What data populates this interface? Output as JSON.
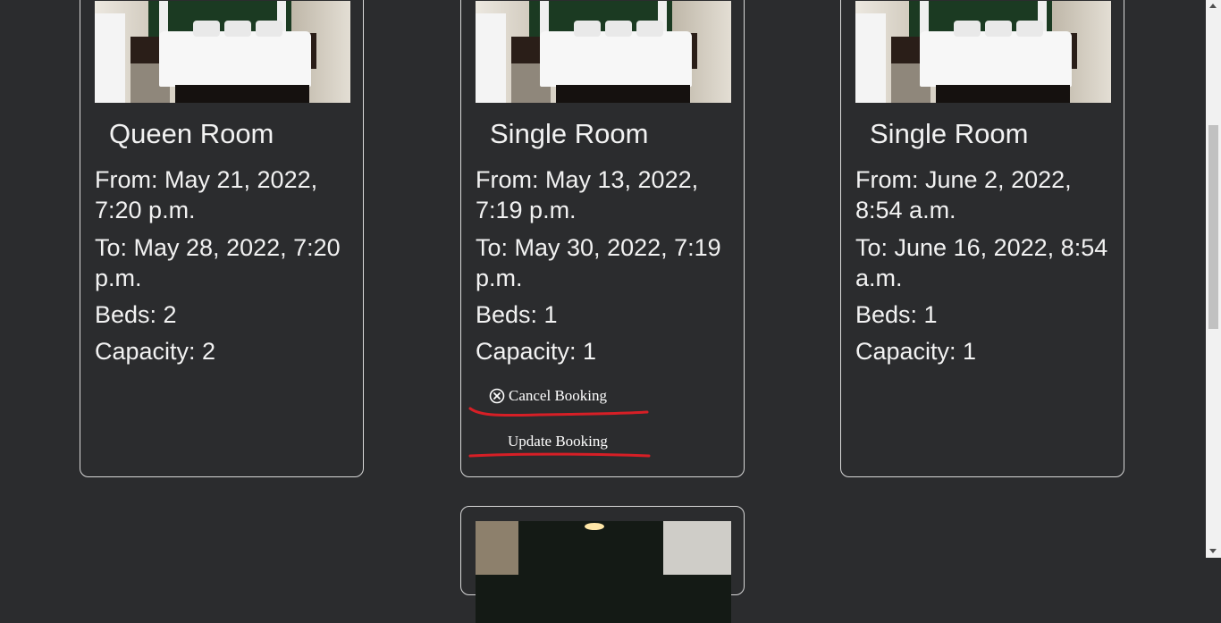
{
  "bookings": [
    {
      "title": "Queen Room",
      "from": "From: May 21, 2022, 7:20 p.m.",
      "to": "To: May 28, 2022, 7:20 p.m.",
      "beds": "Beds: 2",
      "capacity": "Capacity: 2"
    },
    {
      "title": "Single Room",
      "from": "From: May 13, 2022, 7:19 p.m.",
      "to": "To: May 30, 2022, 7:19 p.m.",
      "beds": "Beds: 1",
      "capacity": "Capacity: 1",
      "cancel_label": "Cancel Booking",
      "update_label": "Update Booking"
    },
    {
      "title": "Single Room",
      "from": "From: June 2, 2022, 8:54 a.m.",
      "to": "To: June 16, 2022, 8:54 a.m.",
      "beds": "Beds: 1",
      "capacity": "Capacity: 1"
    }
  ],
  "icons": {
    "cancel": "circle-x-icon"
  },
  "colors": {
    "background": "#2b2c2e",
    "card_border": "#d9d9d9",
    "text": "#f2f2f2",
    "annotation_underline": "#d61f26"
  }
}
